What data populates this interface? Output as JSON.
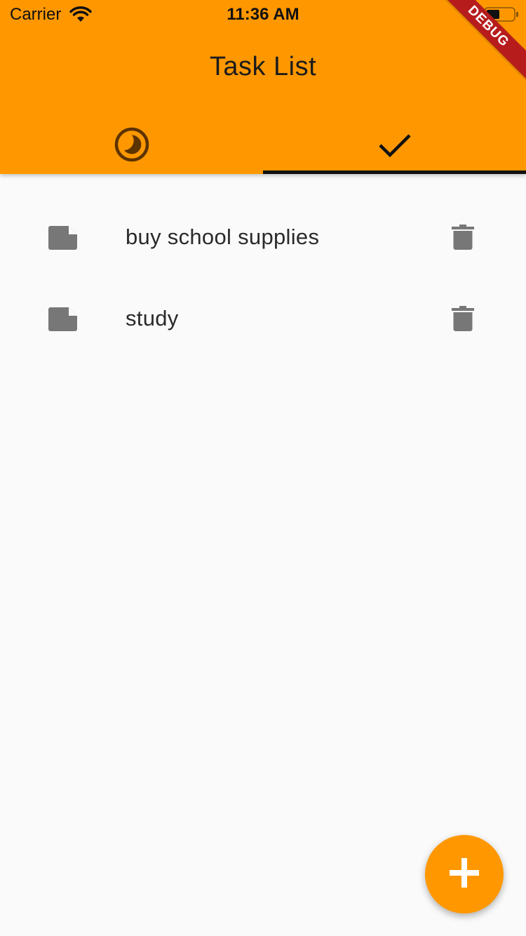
{
  "status_bar": {
    "carrier": "Carrier",
    "time": "11:36 AM"
  },
  "app_bar": {
    "title": "Task List",
    "background_color": "#ff9800",
    "tabs": [
      {
        "icon": "pie-chart-icon",
        "active": false
      },
      {
        "icon": "check-icon",
        "active": true
      }
    ]
  },
  "debug_banner": {
    "label": "DEBUG"
  },
  "tasks": [
    {
      "label": "buy school supplies",
      "icon": "note-icon",
      "action_icon": "delete-icon"
    },
    {
      "label": "study",
      "icon": "note-icon",
      "action_icon": "delete-icon"
    }
  ],
  "fab": {
    "icon": "add-icon",
    "color": "#ff9800"
  }
}
